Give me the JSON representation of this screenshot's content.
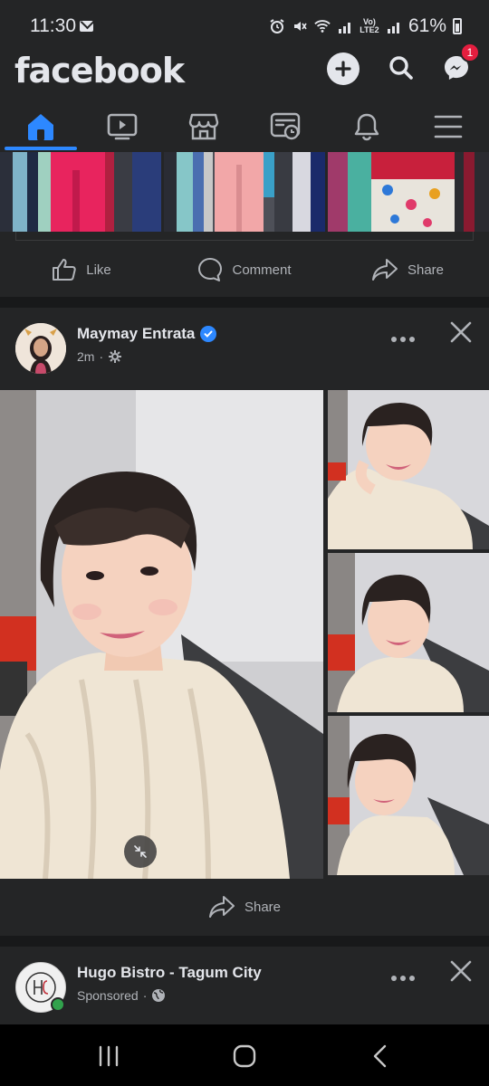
{
  "status": {
    "time": "11:30",
    "battery": "61%",
    "network_label": "Vo) LTE2"
  },
  "header": {
    "logo": "facebook",
    "messenger_badge": "1",
    "icons": [
      "plus-icon",
      "search-icon",
      "messenger-icon"
    ]
  },
  "tabs": [
    {
      "name": "home",
      "active": true
    },
    {
      "name": "video",
      "active": false
    },
    {
      "name": "marketplace",
      "active": false
    },
    {
      "name": "feeds",
      "active": false
    },
    {
      "name": "notifications",
      "active": false
    },
    {
      "name": "menu",
      "active": false
    }
  ],
  "prev_post": {
    "actions": {
      "like": "Like",
      "comment": "Comment",
      "share": "Share"
    }
  },
  "post": {
    "author": "Maymay Entrata",
    "time": "2m",
    "separator": "·",
    "share_label": "Share"
  },
  "sponsored_post": {
    "author": "Hugo Bistro - Tagum City",
    "label": "Sponsored",
    "separator": "·"
  },
  "colors": {
    "accent": "#2d88ff",
    "background": "#18191a",
    "card": "#242526",
    "badge": "#e41e3f"
  }
}
